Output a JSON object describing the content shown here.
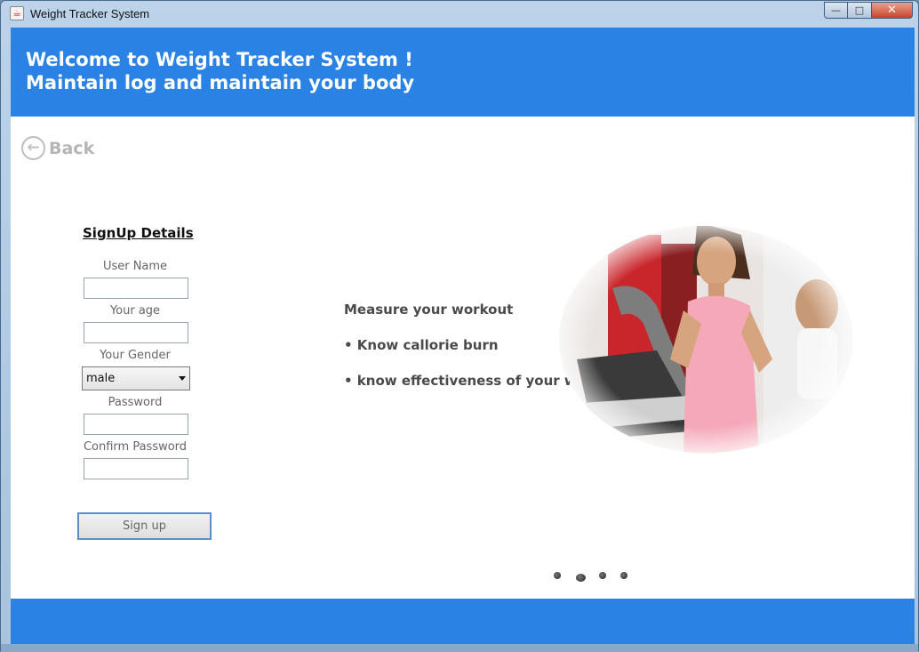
{
  "window": {
    "title": "Weight Tracker System",
    "icon": "java-cup-icon",
    "controls": {
      "minimize": "—",
      "maximize": "□",
      "close": "✕"
    }
  },
  "header": {
    "line1": "Welcome to Weight Tracker System !",
    "line2": "Maintain log and maintain your body",
    "color": "#2a82e4"
  },
  "back": {
    "label": "Back",
    "icon": "arrow-left-circle-icon"
  },
  "signup": {
    "title": "SignUp Details",
    "user_name_label": "User Name",
    "user_name_value": "",
    "age_label": "Your age",
    "age_value": "",
    "gender_label": "Your Gender",
    "gender_value": "male",
    "password_label": "Password",
    "password_value": "",
    "confirm_password_label": "Confirm Password",
    "confirm_password_value": "",
    "button_label": "Sign up"
  },
  "features": {
    "heading": "Measure your workout",
    "item1": "• Know callorie burn",
    "item2": "• know effectiveness of your workout"
  },
  "carousel": {
    "slide_count": 4,
    "active_index": 1
  }
}
